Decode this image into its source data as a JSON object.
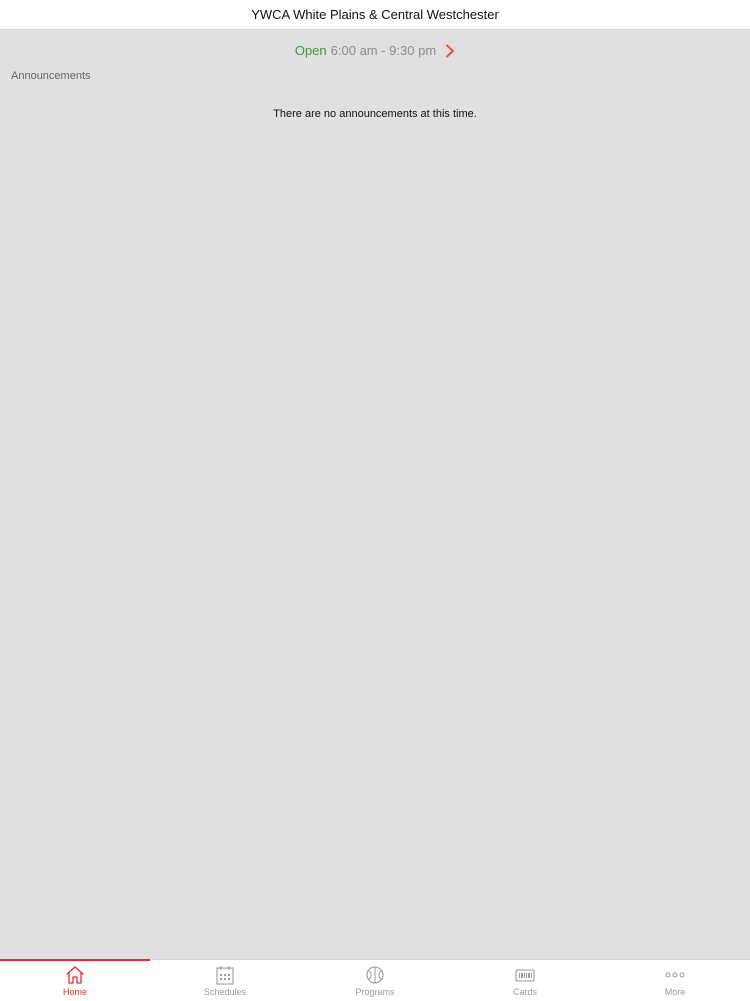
{
  "header": {
    "title": "YWCA White Plains & Central Westchester"
  },
  "hours": {
    "status": "Open",
    "range": "6:00 am - 9:30 pm"
  },
  "announcements": {
    "section_label": "Announcements",
    "empty_message": "There are no announcements at this time."
  },
  "tabbar": {
    "tabs": [
      {
        "label": "Home",
        "icon": "home-icon",
        "active": true
      },
      {
        "label": "Schedules",
        "icon": "calendar-icon",
        "active": false
      },
      {
        "label": "Programs",
        "icon": "basketball-icon",
        "active": false
      },
      {
        "label": "Cards",
        "icon": "card-icon",
        "active": false
      },
      {
        "label": "More",
        "icon": "more-dots-icon",
        "active": false
      }
    ]
  },
  "colors": {
    "accent": "#e62b33",
    "open_status": "#3f9a2c",
    "background": "#e0dfe1",
    "chevron": "#e8592a",
    "inactive_tab": "#9a9a9a"
  }
}
